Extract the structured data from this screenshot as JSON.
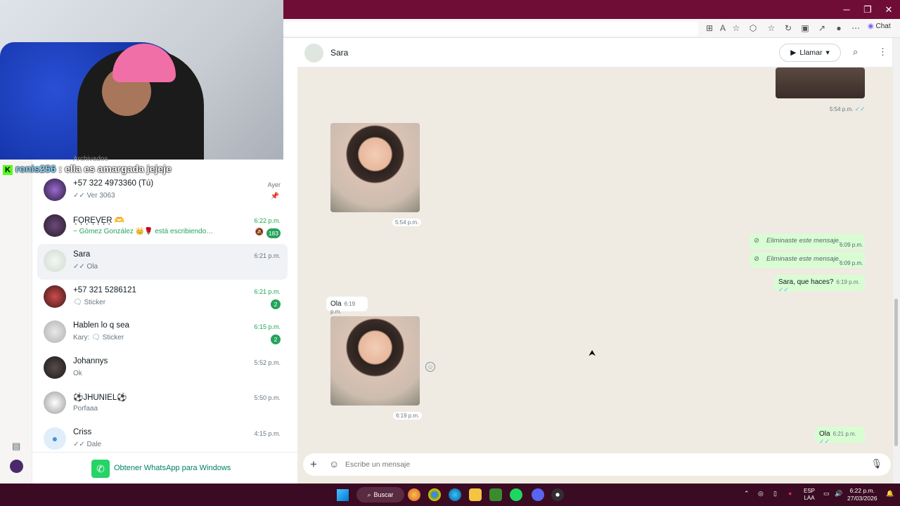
{
  "overlay_chat": {
    "platform_badge": "K",
    "username": "ronis256",
    "message": " : ella es amargada jejeje"
  },
  "browser": {
    "chat_label": "Chat"
  },
  "sidebar": {
    "archived_label": "Archivados",
    "chats": [
      {
        "name": "+57 322 4973360 (Tú)",
        "preview": "✓✓ Ver 3063",
        "time": "Ayer",
        "pinned": true,
        "avatar_color": "#4b2a6b"
      },
      {
        "name": "F͎O͎R͎E͎V͎E͎R͎ 🫶",
        "preview": "~ Gómez González 👑🌹 está escribiendo…",
        "time": "6:22 p.m.",
        "badge": "183",
        "muted": true,
        "typing": true,
        "avatar_color": "#3a2a4a"
      },
      {
        "name": "Sara",
        "preview": "✓✓ Ola",
        "time": "6:21 p.m.",
        "active": true,
        "avatar_color": "#dfe6e0"
      },
      {
        "name": "+57 321 5286121",
        "preview": "🗨 Sticker",
        "time": "6:21 p.m.",
        "badge": "2",
        "avatar_color": "#8a2a2a"
      },
      {
        "name": "Hablen lo q sea",
        "preview": "Kary: 🗨 Sticker",
        "time": "6:15 p.m.",
        "badge": "2",
        "avatar_color": "#c8c8c8"
      },
      {
        "name": "Johannys",
        "preview": "Ok",
        "time": "5:52 p.m.",
        "avatar_color": "#2a2a2a"
      },
      {
        "name": "⚽JHUNIEL⚽",
        "preview": "Porfaaa",
        "time": "5:50 p.m.",
        "avatar_color": "#e0e0e0"
      },
      {
        "name": "Criss",
        "preview": "✓✓ Dale",
        "time": "4:15 p.m.",
        "avatar_color": "#cfe3f5"
      }
    ],
    "get_app_label": "Obtener WhatsApp para Windows"
  },
  "chat": {
    "contact_name": "Sara",
    "call_label": "Llamar",
    "messages": {
      "img_top_time": "5:54 p.m.",
      "img1_time": "5:54 p.m.",
      "deleted1_text": "Eliminaste este mensaje.",
      "deleted1_time": "6:09 p.m.",
      "deleted2_text": "Eliminaste este mensaje.",
      "deleted2_time": "6:09 p.m.",
      "out1_text": "Sara, que haces?",
      "out1_time": "6:19 p.m.",
      "in1_text": "Ola",
      "in1_time": "6:19 p.m.",
      "img2_time": "6:19 p.m.",
      "out2_text": "Ola",
      "out2_time": "6:21 p.m."
    },
    "composer_placeholder": "Escribe un mensaje"
  },
  "taskbar": {
    "search_label": "Buscar",
    "lang_line1": "ESP",
    "lang_line2": "LAA",
    "time": "6:22 p.m.",
    "date": "27/03/2026"
  }
}
